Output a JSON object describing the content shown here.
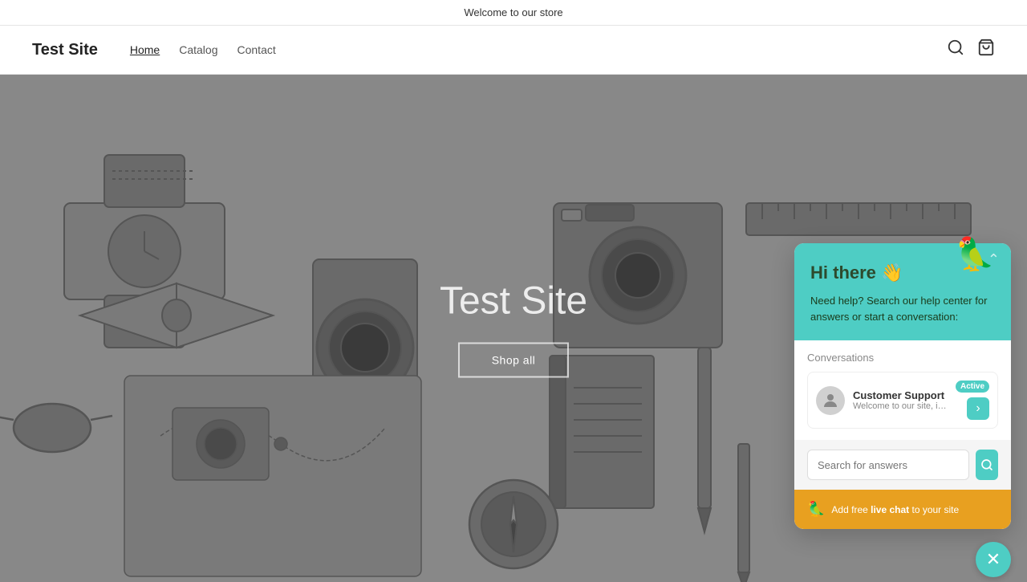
{
  "banner": {
    "text": "Welcome to our store"
  },
  "header": {
    "site_title": "Test Site",
    "nav": [
      {
        "label": "Home",
        "active": true
      },
      {
        "label": "Catalog",
        "active": false
      },
      {
        "label": "Contact",
        "active": false
      }
    ],
    "icons": {
      "search": "🔍",
      "cart": "🛒"
    }
  },
  "hero": {
    "title": "Test Site",
    "shop_all_label": "Shop all"
  },
  "chat_widget": {
    "greeting": "Hi there 👋",
    "bird_emoji": "🦜",
    "subtitle": "Need help? Search our help center for answers or start a conversation:",
    "conversations_label": "Conversations",
    "conversation": {
      "name": "Customer Support",
      "preview": "Welcome to our site, if you ne...",
      "active_badge": "Active",
      "avatar": "👤"
    },
    "search_placeholder": "Search for answers",
    "cta_icon": "🦜",
    "cta_text": "Add free ",
    "cta_bold": "live chat",
    "cta_suffix": " to your site",
    "close_icon": "✕",
    "collapse_icon": "⌃"
  }
}
